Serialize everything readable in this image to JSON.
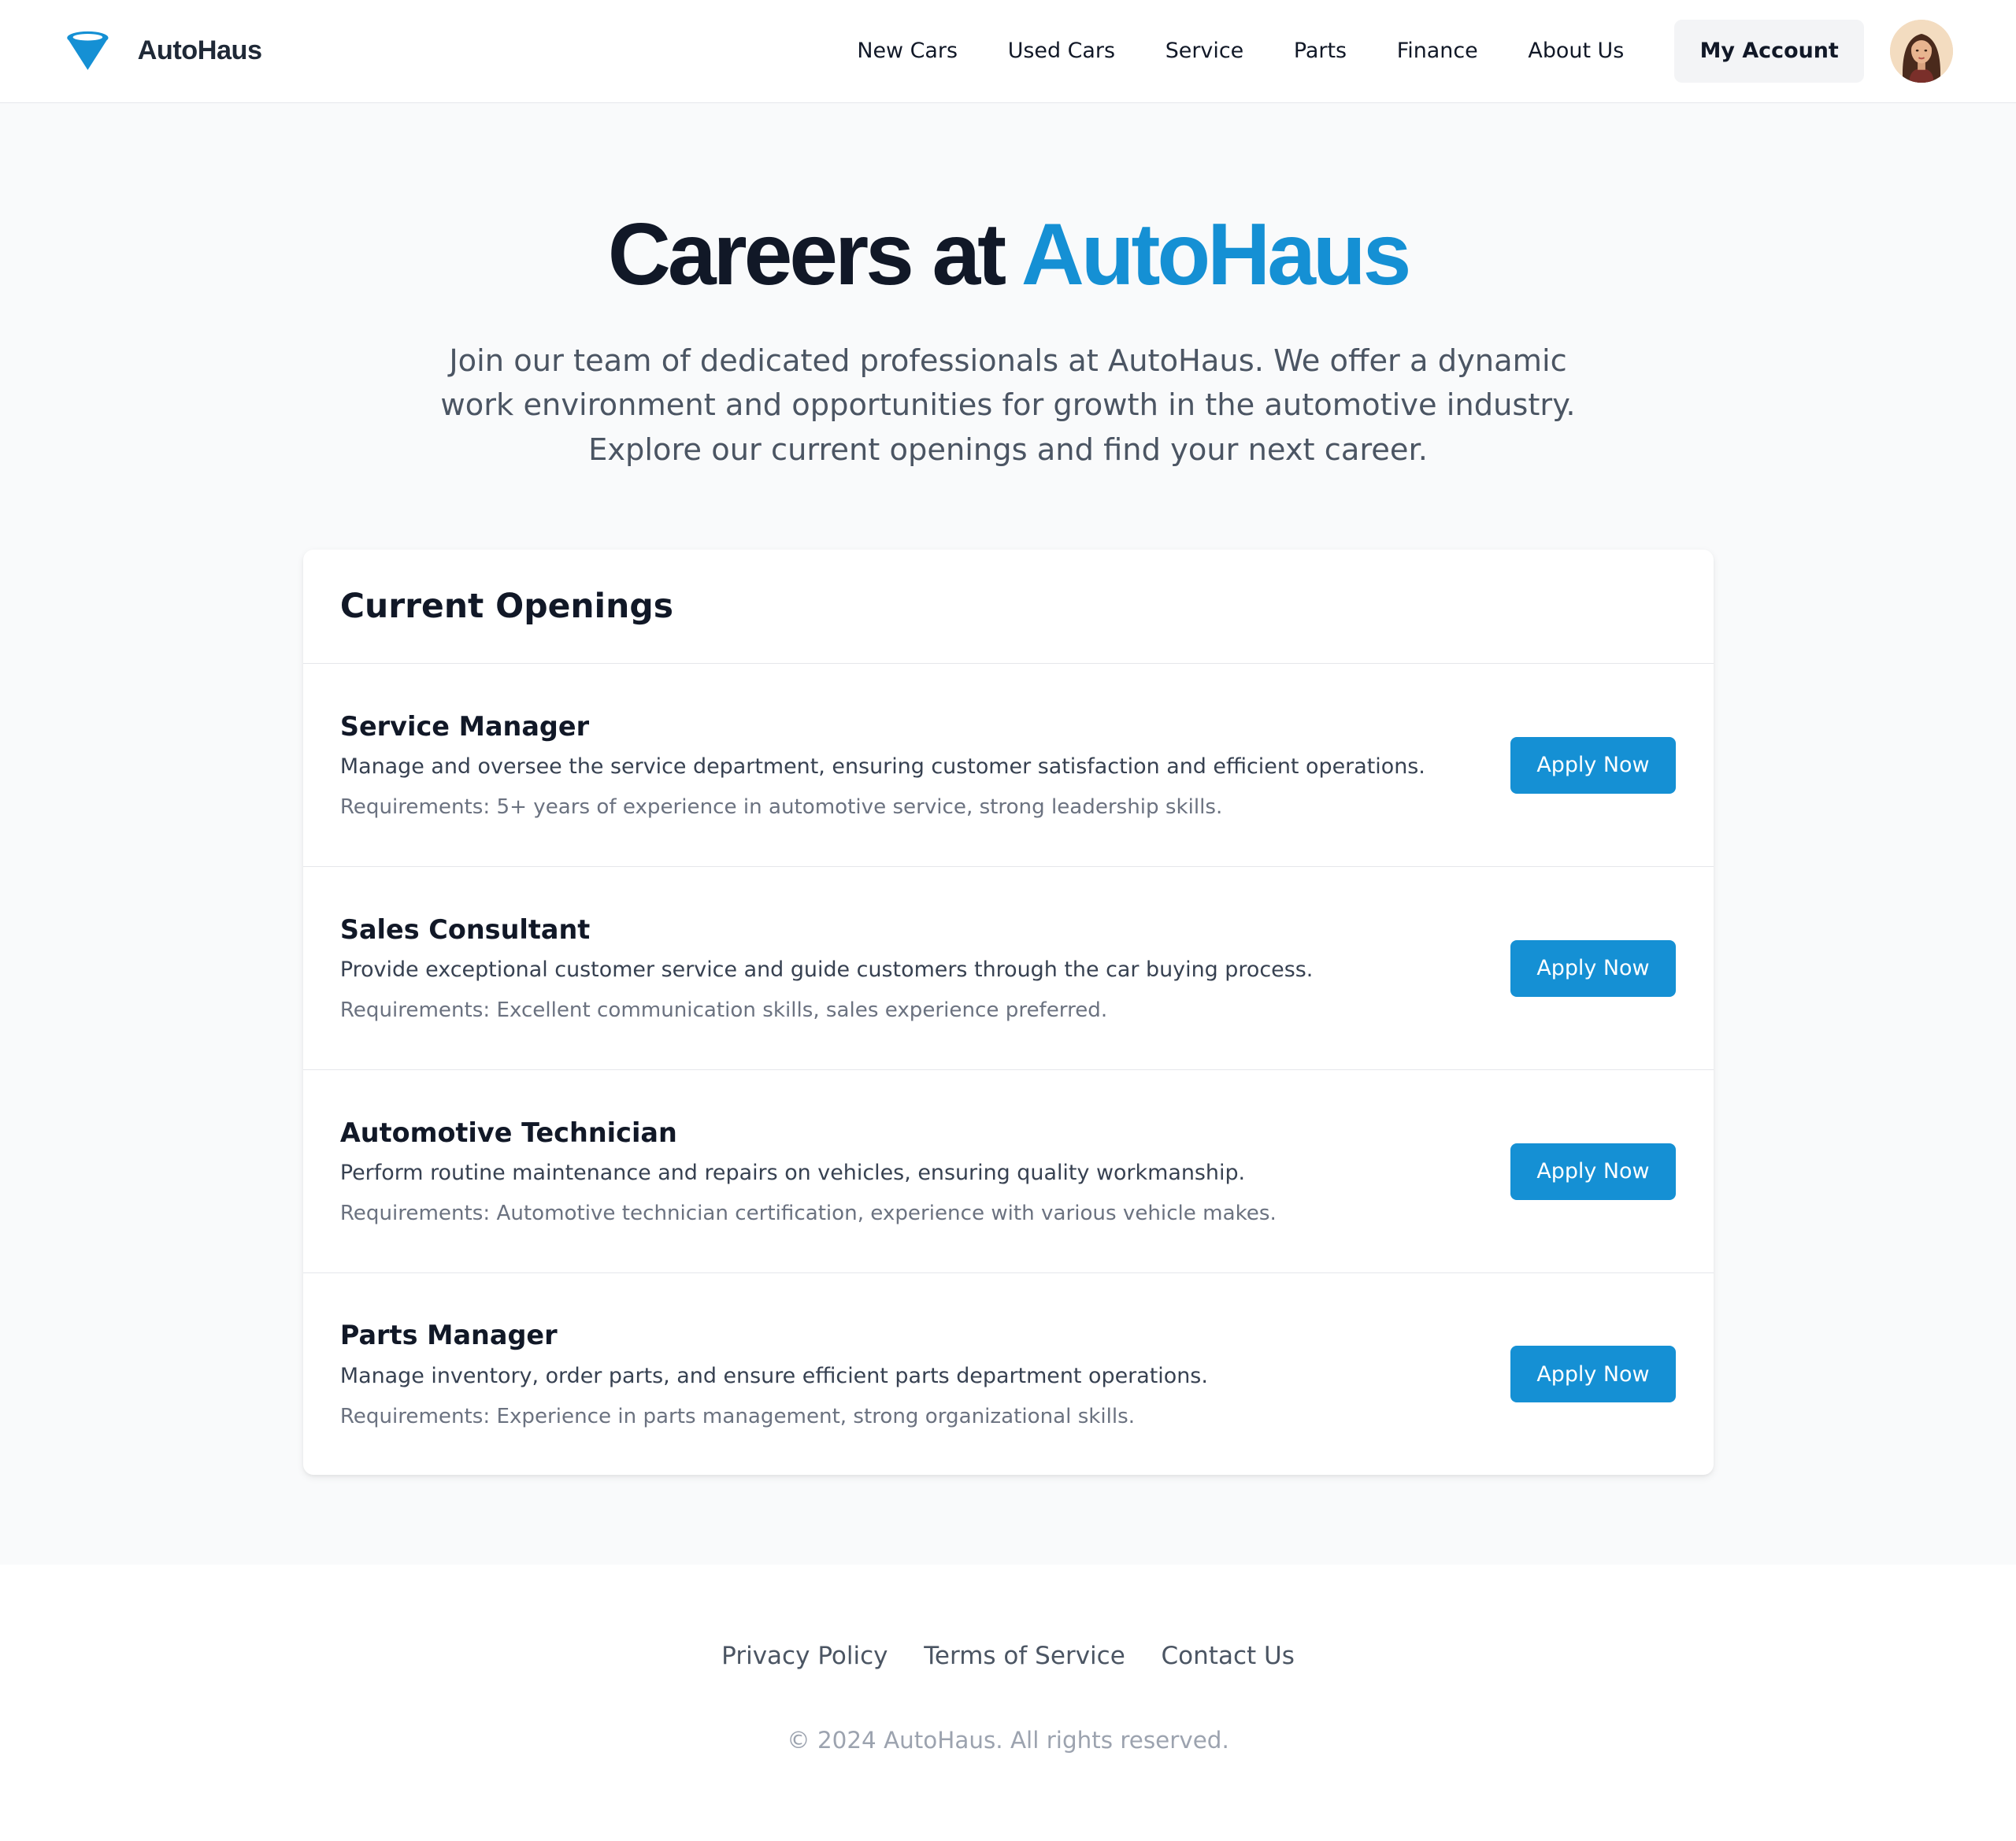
{
  "header": {
    "brand": "AutoHaus",
    "logo_icon": "funnel-logo-icon",
    "nav": [
      "New Cars",
      "Used Cars",
      "Service",
      "Parts",
      "Finance",
      "About Us"
    ],
    "account_label": "My Account",
    "avatar_icon": "user-avatar"
  },
  "hero": {
    "title_prefix": "Careers at",
    "title_accent": "AutoHaus",
    "subtitle": "Join our team of dedicated professionals at AutoHaus. We offer a dynamic work environment and opportunities for growth in the automotive industry. Explore our current openings and find your next career."
  },
  "openings": {
    "heading": "Current Openings",
    "jobs": [
      {
        "title": "Service Manager",
        "description": "Manage and oversee the service department, ensuring customer satisfaction and efficient operations.",
        "requirements": "Requirements: 5+ years of experience in automotive service, strong leadership skills.",
        "button": "Apply Now"
      },
      {
        "title": "Sales Consultant",
        "description": "Provide exceptional customer service and guide customers through the car buying process.",
        "requirements": "Requirements: Excellent communication skills, sales experience preferred.",
        "button": "Apply Now"
      },
      {
        "title": "Automotive Technician",
        "description": "Perform routine maintenance and repairs on vehicles, ensuring quality workmanship.",
        "requirements": "Requirements: Automotive technician certification, experience with various vehicle makes.",
        "button": "Apply Now"
      },
      {
        "title": "Parts Manager",
        "description": "Manage inventory, order parts, and ensure efficient parts department operations.",
        "requirements": "Requirements: Experience in parts management, strong organizational skills.",
        "button": "Apply Now"
      }
    ]
  },
  "footer": {
    "links": [
      "Privacy Policy",
      "Terms of Service",
      "Contact Us"
    ],
    "copyright": "© 2024 AutoHaus. All rights reserved."
  },
  "colors": {
    "accent": "#1590d4",
    "heading": "#111827",
    "muted": "#6b7280",
    "page_bg": "#f9fafb"
  }
}
